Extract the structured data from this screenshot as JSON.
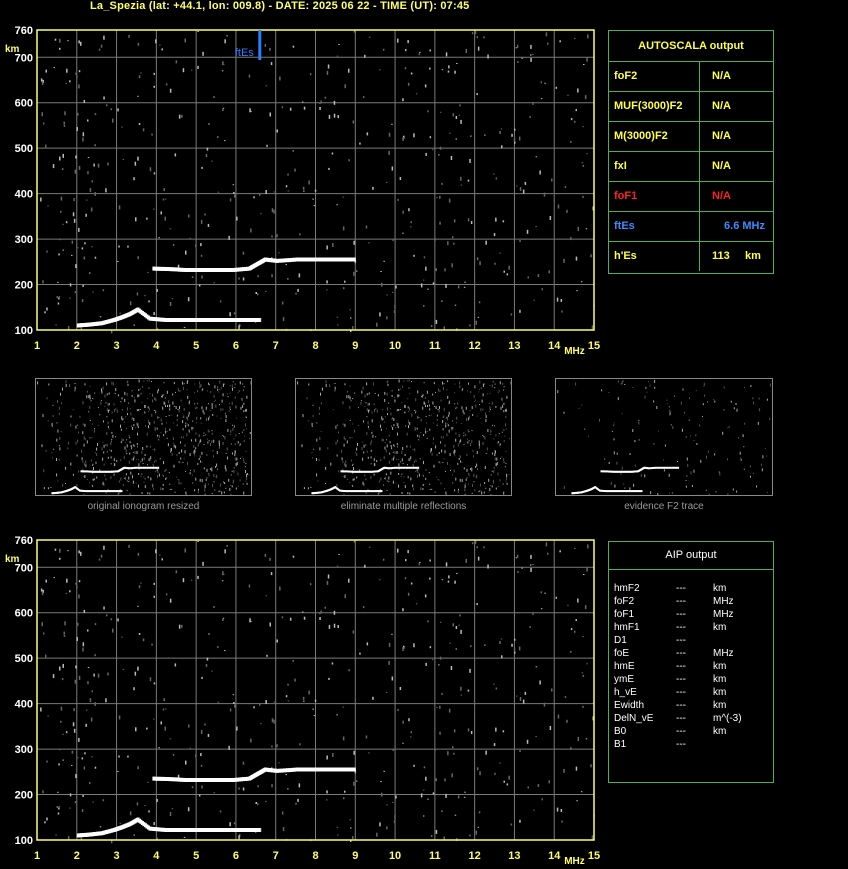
{
  "header": "La_Spezia (lat: +44.1, lon: 009.8) - DATE: 2025 06 22 - TIME (UT): 07:45",
  "colors": {
    "axis": "#ffff66",
    "grid": "#7a7a7a",
    "trace": "#ffffff",
    "ftes": "#2a7fff",
    "panel_border": "#4caf50",
    "fof1": "#ff2222",
    "label": "#ffff44"
  },
  "chart_data": [
    {
      "type": "scatter",
      "title": "",
      "xlabel": "MHz",
      "ylabel": "km",
      "xlim": [
        1,
        15
      ],
      "ylim": [
        100,
        760
      ],
      "x_ticks": [
        "1",
        "2",
        "3",
        "4",
        "5",
        "6",
        "7",
        "8",
        "9",
        "10",
        "11",
        "12",
        "13",
        "14",
        "15"
      ],
      "y_ticks": [
        "100",
        "200",
        "300",
        "400",
        "500",
        "600",
        "700",
        "760"
      ],
      "grid": true,
      "marker_label": "ftEs",
      "marker_x": 6.6,
      "traces": [
        {
          "name": "",
          "x": [
            2.0,
            2.3,
            2.6,
            2.9,
            3.1,
            3.3,
            3.5,
            3.8,
            4.2,
            4.6,
            5.0,
            5.4,
            5.8,
            6.2,
            6.6
          ],
          "y": [
            110,
            112,
            115,
            122,
            128,
            135,
            145,
            125,
            122,
            122,
            122,
            122,
            122,
            122,
            122
          ]
        },
        {
          "name": "",
          "x": [
            3.9,
            4.3,
            4.7,
            5.1,
            5.5,
            5.9,
            6.3,
            6.5,
            6.7,
            7.0,
            7.5,
            8.0,
            8.5,
            9.0
          ],
          "y": [
            235,
            234,
            232,
            232,
            232,
            232,
            235,
            245,
            255,
            252,
            255,
            255,
            255,
            255
          ]
        }
      ]
    },
    {
      "type": "scatter",
      "title": "",
      "xlabel": "MHz",
      "ylabel": "km",
      "xlim": [
        1,
        15
      ],
      "ylim": [
        100,
        760
      ],
      "x_ticks": [
        "1",
        "2",
        "3",
        "4",
        "5",
        "6",
        "7",
        "8",
        "9",
        "10",
        "11",
        "12",
        "13",
        "14",
        "15"
      ],
      "y_ticks": [
        "100",
        "200",
        "300",
        "400",
        "500",
        "600",
        "700",
        "760"
      ],
      "grid": true
    }
  ],
  "autoscala": {
    "title": "AUTOSCALA output",
    "rows": [
      {
        "name": "foF2",
        "value": "N/A"
      },
      {
        "name": "MUF(3000)F2",
        "value": "N/A"
      },
      {
        "name": "M(3000)F2",
        "value": "N/A"
      },
      {
        "name": "fxI",
        "value": "N/A"
      },
      {
        "name": "foF1",
        "value": "N/A"
      },
      {
        "name": "ftEs",
        "value": "6.6 MHz"
      },
      {
        "name": "h'Es",
        "value": "113     km"
      }
    ]
  },
  "thumbnails": [
    {
      "caption": "original ionogram resized"
    },
    {
      "caption": "eliminate multiple reflections"
    },
    {
      "caption": "evidence F2 trace"
    }
  ],
  "aip": {
    "title": "AIP output",
    "rows": [
      {
        "name": "hmF2",
        "value": "---",
        "unit": "km"
      },
      {
        "name": "foF2",
        "value": "---",
        "unit": "MHz"
      },
      {
        "name": "foF1",
        "value": "---",
        "unit": "MHz"
      },
      {
        "name": "hmF1",
        "value": "---",
        "unit": "km"
      },
      {
        "name": "D1",
        "value": "---",
        "unit": ""
      },
      {
        "name": "foE",
        "value": "---",
        "unit": "MHz"
      },
      {
        "name": "hmE",
        "value": "---",
        "unit": "km"
      },
      {
        "name": "ymE",
        "value": "---",
        "unit": "km"
      },
      {
        "name": "h_vE",
        "value": "---",
        "unit": "km"
      },
      {
        "name": "Ewidth",
        "value": "---",
        "unit": "km"
      },
      {
        "name": "DelN_vE",
        "value": "---",
        "unit": "m^(-3)"
      },
      {
        "name": "B0",
        "value": "---",
        "unit": "km"
      },
      {
        "name": "B1",
        "value": "---",
        "unit": ""
      }
    ]
  }
}
